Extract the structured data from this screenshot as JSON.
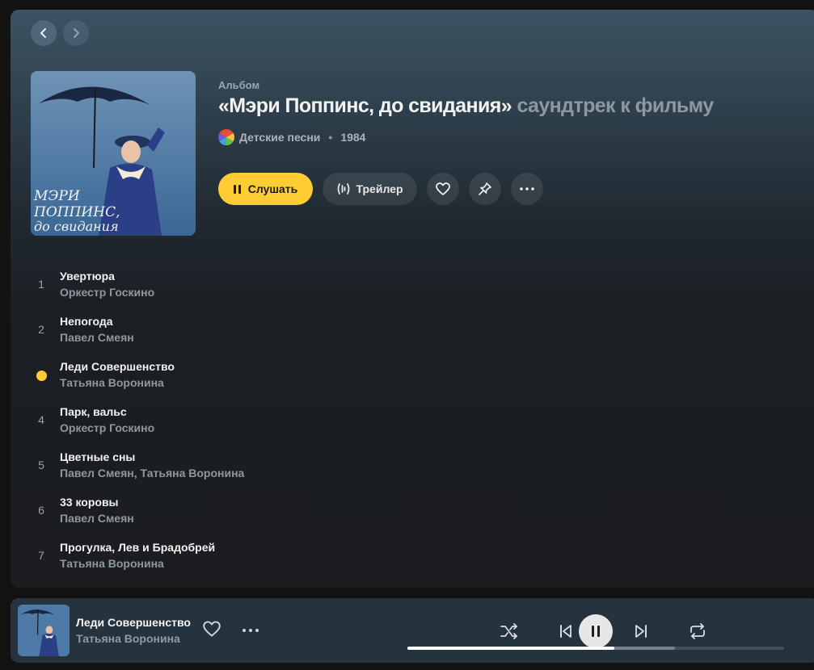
{
  "album": {
    "type_label": "Альбом",
    "title": "«Мэри Поппинс, до свидания»",
    "version": "саундтрек к фильму",
    "artist": "Детские песни",
    "year": "1984",
    "cover_text": "МЭРИ ПОППИНС, до свидания"
  },
  "actions": {
    "play_label": "Слушать",
    "trailer_label": "Трейлер"
  },
  "tracks": [
    {
      "num": "1",
      "title": "Увертюра",
      "artist": "Оркестр Госкино",
      "playing": false
    },
    {
      "num": "2",
      "title": "Непогода",
      "artist": "Павел Смеян",
      "playing": false
    },
    {
      "num": "3",
      "title": "Леди Совершенство",
      "artist": "Татьяна Воронина",
      "playing": true
    },
    {
      "num": "4",
      "title": "Парк, вальс",
      "artist": "Оркестр Госкино",
      "playing": false
    },
    {
      "num": "5",
      "title": "Цветные сны",
      "artist": "Павел Смеян, Татьяна Воронина",
      "playing": false
    },
    {
      "num": "6",
      "title": "33 коровы",
      "artist": "Павел Смеян",
      "playing": false
    },
    {
      "num": "7",
      "title": "Прогулка, Лев и Брадобрей",
      "artist": "Татьяна Воронина",
      "playing": false
    }
  ],
  "player": {
    "title": "Леди Совершенство",
    "artist": "Татьяна Воронина",
    "progress_played": 0.55,
    "progress_buffered": 0.71
  },
  "colors": {
    "accent": "#ffcc33",
    "panel_top": "#3c5363",
    "panel_bottom": "#1b1d20",
    "player_bg": "#25333f"
  },
  "icons": {
    "back": "chevron-left-icon",
    "forward": "chevron-right-icon",
    "play": "pause-icon",
    "trailer": "sound-wave-icon",
    "like": "heart-icon",
    "pin": "pin-icon",
    "more": "more-dots-icon",
    "shuffle": "shuffle-icon",
    "prev": "previous-icon",
    "pause": "pause-icon",
    "next": "next-icon",
    "repeat": "repeat-icon"
  }
}
